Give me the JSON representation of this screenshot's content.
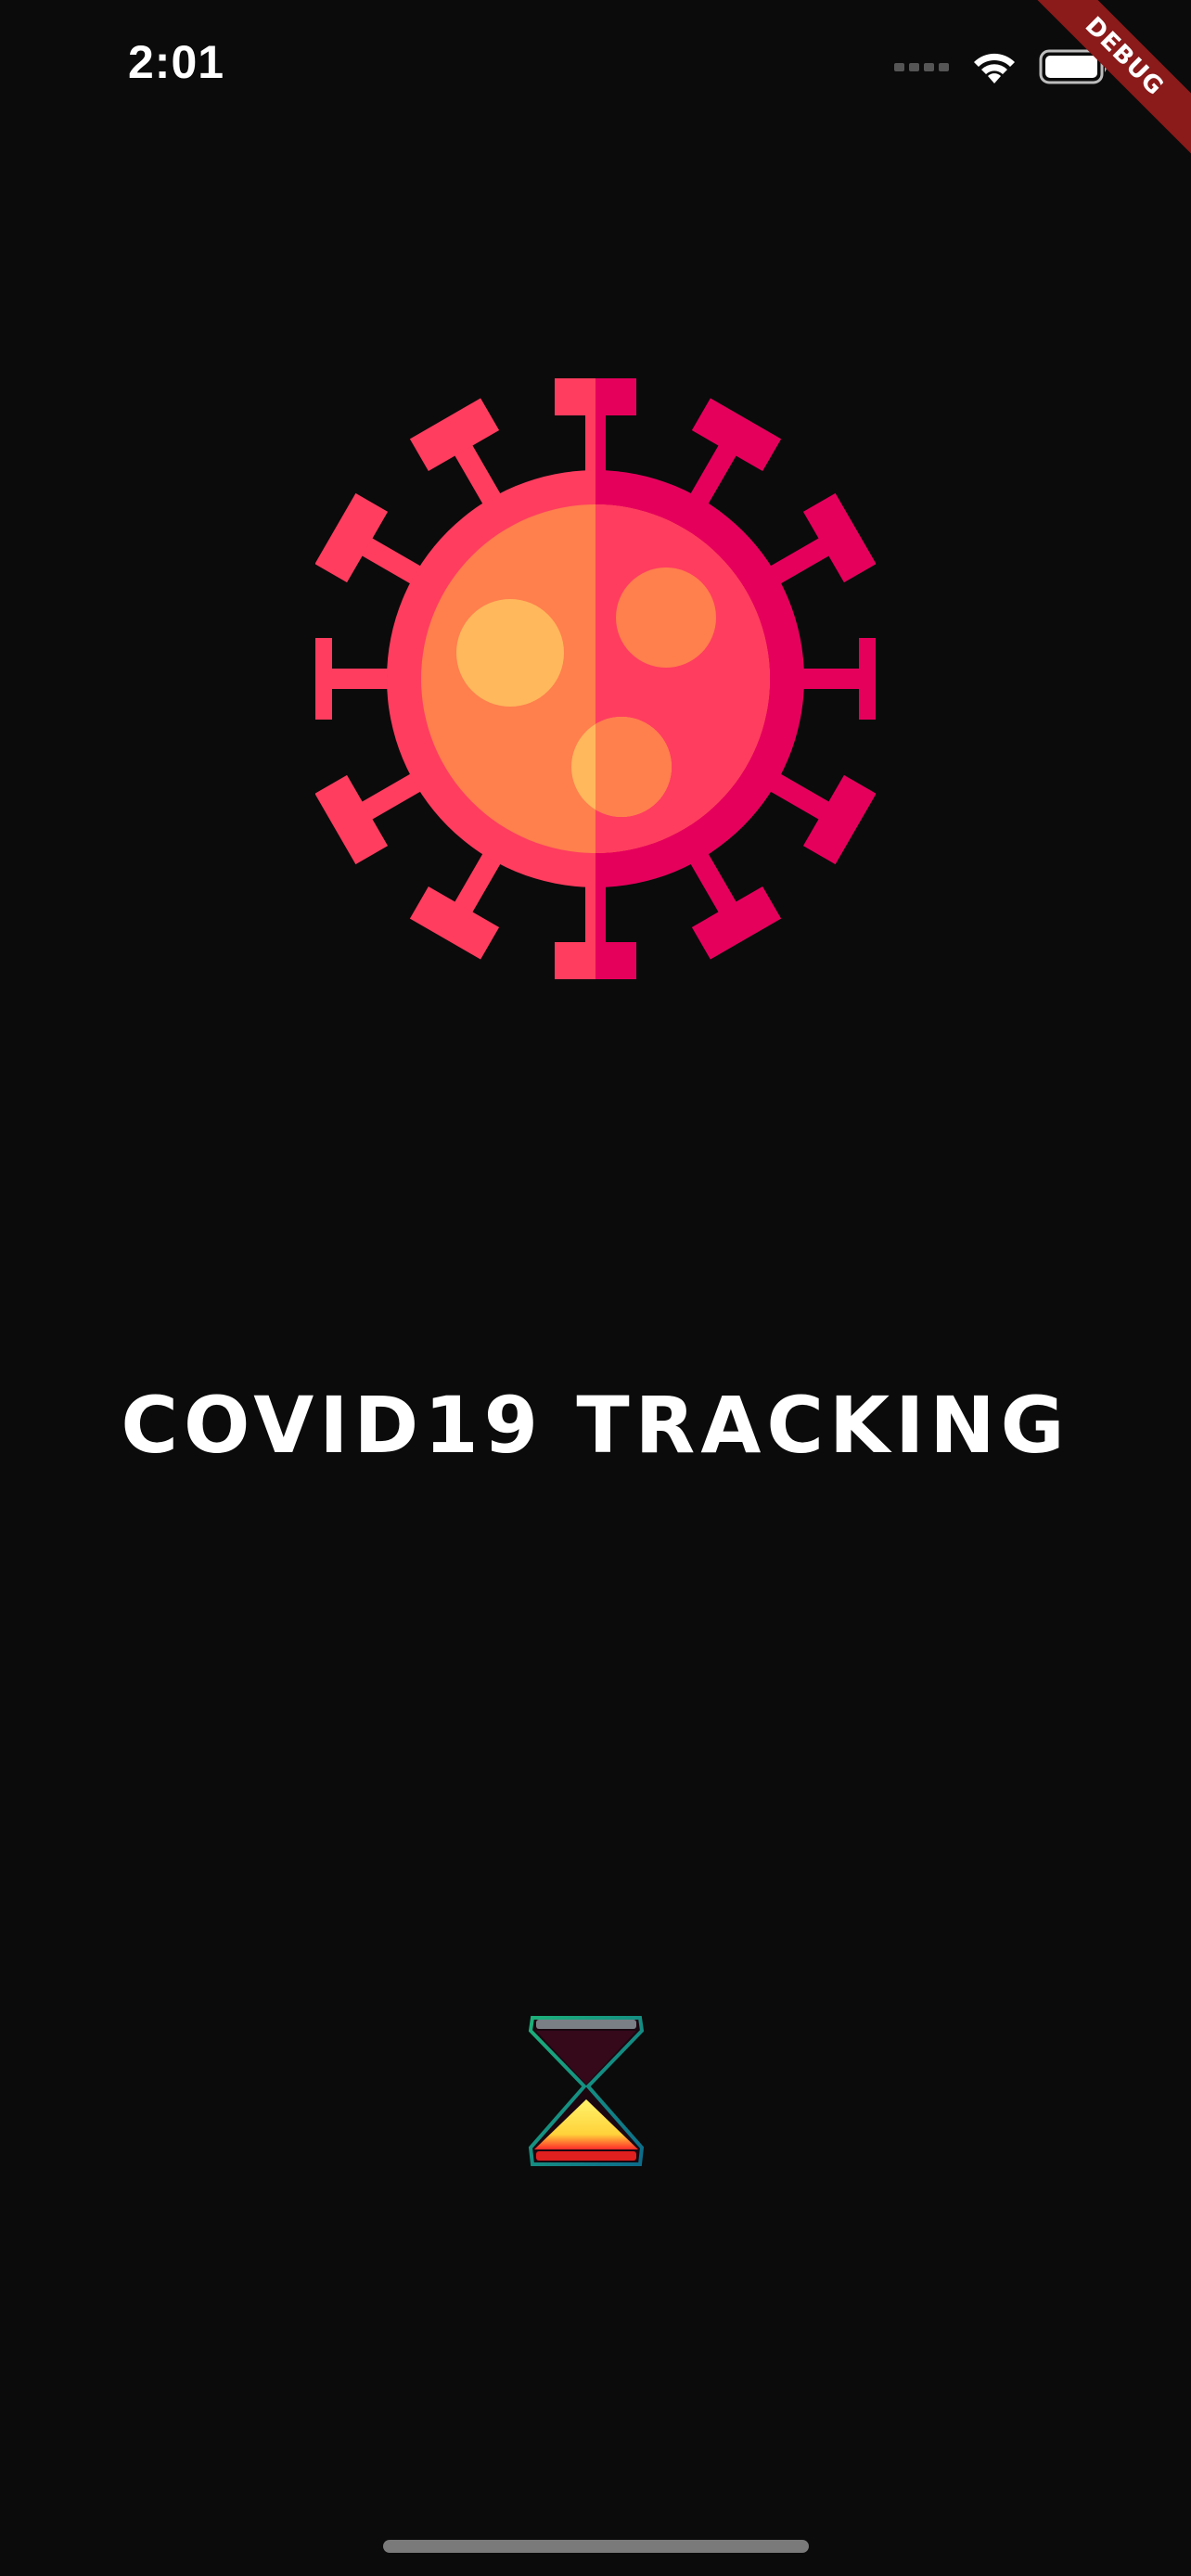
{
  "status_bar": {
    "time": "2:01",
    "icons": [
      "signal-icon",
      "wifi-icon",
      "battery-icon"
    ]
  },
  "debug_banner": {
    "label": "DEBUG",
    "color": "#8b1a1a"
  },
  "splash": {
    "title": "COVID19 TRACKING",
    "logo_icon": "virus-icon",
    "loader_icon": "hourglass-icon"
  },
  "colors": {
    "background": "#0b0b0b",
    "virus_left": "#ff3d5f",
    "virus_right": "#e5005c",
    "virus_core": "#ff7f4d",
    "virus_dots": "#ffb85c",
    "title": "#ffffff"
  }
}
